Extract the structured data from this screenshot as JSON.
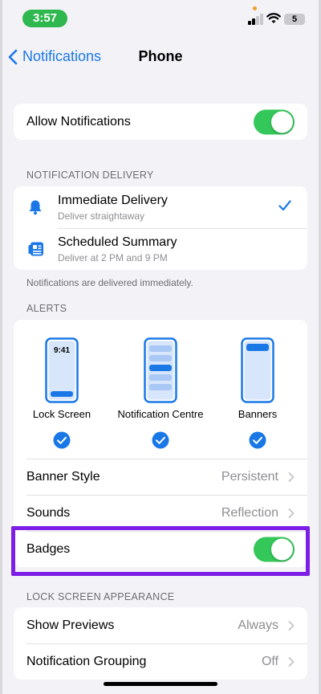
{
  "status_bar": {
    "time": "3:57",
    "battery": "5"
  },
  "nav": {
    "back_label": "Notifications",
    "title": "Phone"
  },
  "allow": {
    "label": "Allow Notifications",
    "on": true
  },
  "delivery": {
    "header": "NOTIFICATION DELIVERY",
    "items": [
      {
        "title": "Immediate Delivery",
        "subtitle": "Deliver straightaway",
        "icon": "bell-icon",
        "selected": true
      },
      {
        "title": "Scheduled Summary",
        "subtitle": "Deliver at 2 PM and 9 PM",
        "icon": "summary-icon",
        "selected": false
      }
    ],
    "footnote": "Notifications are delivered immediately."
  },
  "alerts": {
    "header": "ALERTS",
    "options": [
      {
        "label": "Lock Screen",
        "phone_time": "9:41",
        "checked": true
      },
      {
        "label": "Notification Centre",
        "checked": true
      },
      {
        "label": "Banners",
        "checked": true
      }
    ],
    "rows": [
      {
        "label": "Banner Style",
        "value": "Persistent"
      },
      {
        "label": "Sounds",
        "value": "Reflection"
      }
    ],
    "badges": {
      "label": "Badges",
      "on": true
    }
  },
  "lock_screen": {
    "header": "LOCK SCREEN APPEARANCE",
    "rows": [
      {
        "label": "Show Previews",
        "value": "Always"
      },
      {
        "label": "Notification Grouping",
        "value": "Off"
      }
    ]
  },
  "colors": {
    "accent": "#1a78e6",
    "toggle_on": "#34c759",
    "highlight": "#7d1ee6",
    "time_pill": "#2fb84f"
  }
}
